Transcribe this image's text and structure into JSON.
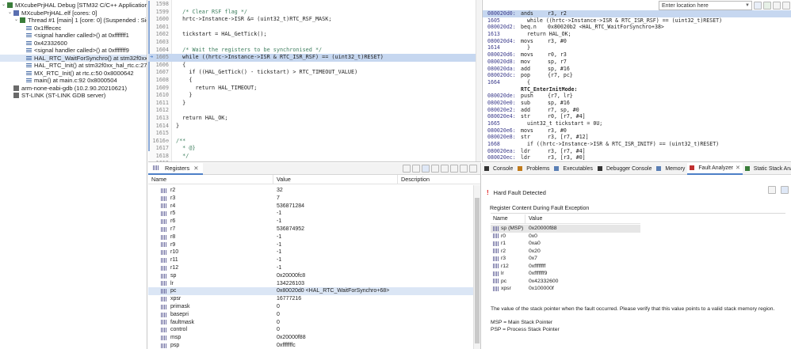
{
  "debug_tree": [
    {
      "indent": 0,
      "label": "MXcubePrjHAL Debug [STM32 C/C++ Application]",
      "icon": "debug-config-icon",
      "twisty": "v"
    },
    {
      "indent": 1,
      "label": "MXcubePrjHAL.elf [cores: 0]",
      "icon": "elf-icon",
      "twisty": "v"
    },
    {
      "indent": 2,
      "label": "Thread #1 [main] 1 [core: 0] (Suspended : Signal : SIGT",
      "icon": "thread-icon",
      "twisty": "v"
    },
    {
      "indent": 3,
      "label": "0x1fffecec",
      "icon": "stack-frame-icon",
      "twisty": ""
    },
    {
      "indent": 3,
      "label": "<signal handler called>() at 0xfffffff1",
      "icon": "stack-frame-icon",
      "twisty": ""
    },
    {
      "indent": 3,
      "label": "0x42332600",
      "icon": "stack-frame-icon",
      "twisty": ""
    },
    {
      "indent": 3,
      "label": "<signal handler called>() at 0xfffffff9",
      "icon": "stack-frame-icon",
      "twisty": ""
    },
    {
      "indent": 3,
      "label": "HAL_RTC_WaitForSynchro() at stm32f0xx_hal_rtc.c:",
      "icon": "stack-frame-icon",
      "twisty": "",
      "selected": true
    },
    {
      "indent": 3,
      "label": "HAL_RTC_Init() at stm32f0xx_hal_rtc.c:279 0x800203",
      "icon": "stack-frame-icon",
      "twisty": ""
    },
    {
      "indent": 3,
      "label": "MX_RTC_Init() at rtc.c:50 0x8000642",
      "icon": "stack-frame-icon",
      "twisty": ""
    },
    {
      "indent": 3,
      "label": "main() at main.c:92 0x8000504",
      "icon": "stack-frame-icon",
      "twisty": ""
    },
    {
      "indent": 1,
      "label": "arm-none-eabi-gdb (10.2.90.20210621)",
      "icon": "gdb-icon",
      "twisty": ""
    },
    {
      "indent": 1,
      "label": "ST-LINK (ST-LINK GDB server)",
      "icon": "stlink-icon",
      "twisty": ""
    }
  ],
  "editor": {
    "current_line": "1605",
    "lines": [
      {
        "n": "1598",
        "t": ""
      },
      {
        "n": "1599",
        "t": "  /* Clear RSF flag */",
        "c": "cm"
      },
      {
        "n": "1600",
        "t": "  hrtc->Instance->ISR &= (uint32_t)RTC_RSF_MASK;"
      },
      {
        "n": "1601",
        "t": ""
      },
      {
        "n": "1602",
        "t": "  tickstart = HAL_GetTick();"
      },
      {
        "n": "1603",
        "t": ""
      },
      {
        "n": "1604",
        "t": "  /* Wait the registers to be synchronised */",
        "c": "cm"
      },
      {
        "n": "1605",
        "t": "  while ((hrtc->Instance->ISR & RTC_ISR_RSF) == (uint32_t)RESET)",
        "hl": true
      },
      {
        "n": "1606",
        "t": "  {"
      },
      {
        "n": "1607",
        "t": "    if ((HAL_GetTick() - tickstart) > RTC_TIMEOUT_VALUE)"
      },
      {
        "n": "1608",
        "t": "    {"
      },
      {
        "n": "1609",
        "t": "      return HAL_TIMEOUT;"
      },
      {
        "n": "1610",
        "t": "    }"
      },
      {
        "n": "1611",
        "t": "  }"
      },
      {
        "n": "1612",
        "t": ""
      },
      {
        "n": "1613",
        "t": "  return HAL_OK;"
      },
      {
        "n": "1614",
        "t": "}"
      },
      {
        "n": "1615",
        "t": ""
      },
      {
        "n": "1616⊖",
        "t": "/**",
        "c": "cm"
      },
      {
        "n": "1617",
        "t": "  * @}",
        "c": "cm"
      },
      {
        "n": "1618",
        "t": "  */",
        "c": "cm"
      },
      {
        "n": "1619",
        "t": ""
      },
      {
        "n": "1620⊖",
        "t": "/** @addtogroup RTC_Exported_Functions_Group5",
        "c": "cm"
      },
      {
        "n": "1621",
        "t": "  *  @brief    Peripheral State functions",
        "c": "cm"
      }
    ]
  },
  "disasm_toolbar": {
    "location_placeholder": "Enter location here"
  },
  "disasm": [
    {
      "a": "080020d0:",
      "m": "ands",
      "o": "r3, r2",
      "cur": true
    },
    {
      "a": "1605",
      "m": "",
      "o": "",
      "src": "while ((hrtc->Instance->ISR & RTC_ISR_RSF) == (uint32_t)RESET)"
    },
    {
      "a": "080020d2:",
      "m": "beq.n",
      "o": "0x80020b2 <HAL_RTC_WaitForSynchro+38>"
    },
    {
      "a": "1613",
      "m": "",
      "o": "",
      "src": "return HAL_OK;"
    },
    {
      "a": "080020d4:",
      "m": "movs",
      "o": "r3, #0"
    },
    {
      "a": "1614",
      "m": "",
      "o": "",
      "src": "}"
    },
    {
      "a": "080020d6:",
      "m": "movs",
      "o": "r0, r3"
    },
    {
      "a": "080020d8:",
      "m": "mov",
      "o": "sp, r7"
    },
    {
      "a": "080020da:",
      "m": "add",
      "o": "sp, #16"
    },
    {
      "a": "080020dc:",
      "m": "pop",
      "o": "{r7, pc}"
    },
    {
      "a": "1664",
      "m": "",
      "o": "",
      "src": "{"
    },
    {
      "a": "",
      "m": "",
      "o": "",
      "label": "RTC_EnterInitMode:"
    },
    {
      "a": "080020de:",
      "m": "push",
      "o": "{r7, lr}"
    },
    {
      "a": "080020e0:",
      "m": "sub",
      "o": "sp, #16"
    },
    {
      "a": "080020e2:",
      "m": "add",
      "o": "r7, sp, #0"
    },
    {
      "a": "080020e4:",
      "m": "str",
      "o": "r0, [r7, #4]"
    },
    {
      "a": "1665",
      "m": "",
      "o": "",
      "src": "uint32_t tickstart = 0U;"
    },
    {
      "a": "080020e6:",
      "m": "movs",
      "o": "r3, #0"
    },
    {
      "a": "080020e8:",
      "m": "str",
      "o": "r3, [r7, #12]"
    },
    {
      "a": "1668",
      "m": "",
      "o": "",
      "src": "if ((hrtc->Instance->ISR & RTC_ISR_INITF) == (uint32_t)RESET)"
    },
    {
      "a": "080020ea:",
      "m": "ldr",
      "o": "r3, [r7, #4]"
    },
    {
      "a": "080020ec:",
      "m": "ldr",
      "o": "r3, [r3, #0]"
    }
  ],
  "registers_view": {
    "tab": "Registers",
    "columns": [
      "Name",
      "Value",
      "Description"
    ],
    "rows": [
      {
        "n": "r2",
        "v": "32"
      },
      {
        "n": "r3",
        "v": "7"
      },
      {
        "n": "r4",
        "v": "536871284"
      },
      {
        "n": "r5",
        "v": "-1"
      },
      {
        "n": "r6",
        "v": "-1"
      },
      {
        "n": "r7",
        "v": "536874952"
      },
      {
        "n": "r8",
        "v": "-1"
      },
      {
        "n": "r9",
        "v": "-1"
      },
      {
        "n": "r10",
        "v": "-1"
      },
      {
        "n": "r11",
        "v": "-1"
      },
      {
        "n": "r12",
        "v": "-1"
      },
      {
        "n": "sp",
        "v": "0x20000fc8"
      },
      {
        "n": "lr",
        "v": "134226103"
      },
      {
        "n": "pc",
        "v": "0x80020d0 <HAL_RTC_WaitForSynchro+68>",
        "sel": true
      },
      {
        "n": "xpsr",
        "v": "16777216"
      },
      {
        "n": "primask",
        "v": "0"
      },
      {
        "n": "basepri",
        "v": "0"
      },
      {
        "n": "faultmask",
        "v": "0"
      },
      {
        "n": "control",
        "v": "0"
      },
      {
        "n": "msp",
        "v": "0x20000f88"
      },
      {
        "n": "psp",
        "v": "0xfffffffc"
      }
    ]
  },
  "bottom_tabs": [
    {
      "label": "Console",
      "icon": "console-icon"
    },
    {
      "label": "Problems",
      "icon": "problems-icon"
    },
    {
      "label": "Executables",
      "icon": "executables-icon"
    },
    {
      "label": "Debugger Console",
      "icon": "debugger-console-icon"
    },
    {
      "label": "Memory",
      "icon": "memory-icon"
    },
    {
      "label": "Fault Analyzer",
      "icon": "fault-analyzer-icon",
      "active": true
    },
    {
      "label": "Static Stack Analyzer",
      "icon": "stack-analyzer-icon"
    }
  ],
  "fault": {
    "title": "Hard Fault Detected",
    "group_title": "Register Content During Fault Exception",
    "columns": [
      "Name",
      "Value"
    ],
    "rows": [
      {
        "n": "sp (MSP)",
        "v": "0x20000f88",
        "sel": true
      },
      {
        "n": "r0",
        "v": "0x0"
      },
      {
        "n": "r1",
        "v": "0xa0"
      },
      {
        "n": "r2",
        "v": "0x20"
      },
      {
        "n": "r3",
        "v": "0x7"
      },
      {
        "n": "r12",
        "v": "0xffffffff"
      },
      {
        "n": "lr",
        "v": "0xfffffff9"
      },
      {
        "n": "pc",
        "v": "0x42332600"
      },
      {
        "n": "xpsr",
        "v": "0x100000f"
      }
    ],
    "description": "The value of the stack pointer when the fault occurred. Please verify that this value points to a valid stack memory region.",
    "msp": "MSP = Main Stack Pointer",
    "psp": "PSP = Process Stack Pointer"
  },
  "colors": {
    "selection": "#dbe6f5",
    "current_line": "#c6d7f0",
    "accent": "#4d7fc7",
    "error": "#e02020"
  }
}
